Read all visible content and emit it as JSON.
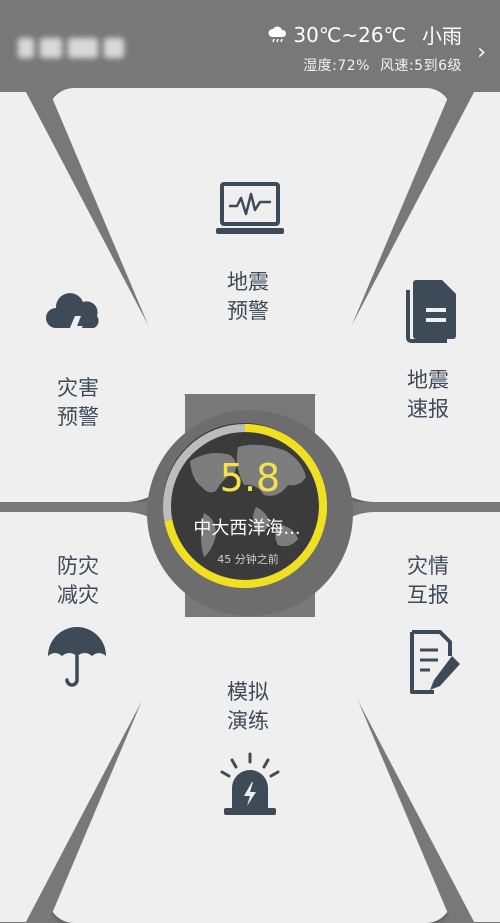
{
  "header": {
    "weather_icon": "cloud-rain-icon",
    "temperature": "30℃~26℃",
    "condition": "小雨",
    "humidity": "湿度:72%",
    "wind": "风速:5到6级",
    "chevron_icon": "chevron-right-icon"
  },
  "tiles": {
    "top": {
      "label_line1": "地震",
      "label_line2": "预警",
      "icon": "monitor-waveform-icon"
    },
    "left_top": {
      "label_line1": "灾害",
      "label_line2": "预警",
      "icon": "storm-cloud-icon"
    },
    "right_top": {
      "label_line1": "地震",
      "label_line2": "速报",
      "icon": "document-icon"
    },
    "left_bottom": {
      "label_line1": "防灾",
      "label_line2": "减灾",
      "icon": "umbrella-icon"
    },
    "right_bottom": {
      "label_line1": "灾情",
      "label_line2": "互报",
      "icon": "edit-document-icon"
    },
    "bottom": {
      "label_line1": "模拟",
      "label_line2": "演练",
      "icon": "alarm-siren-icon"
    }
  },
  "center": {
    "magnitude": "5.8",
    "place": "中大西洋海...",
    "time_ago": "45 分钟之前",
    "accent_color": "#f0e020",
    "progress": 0.72
  }
}
